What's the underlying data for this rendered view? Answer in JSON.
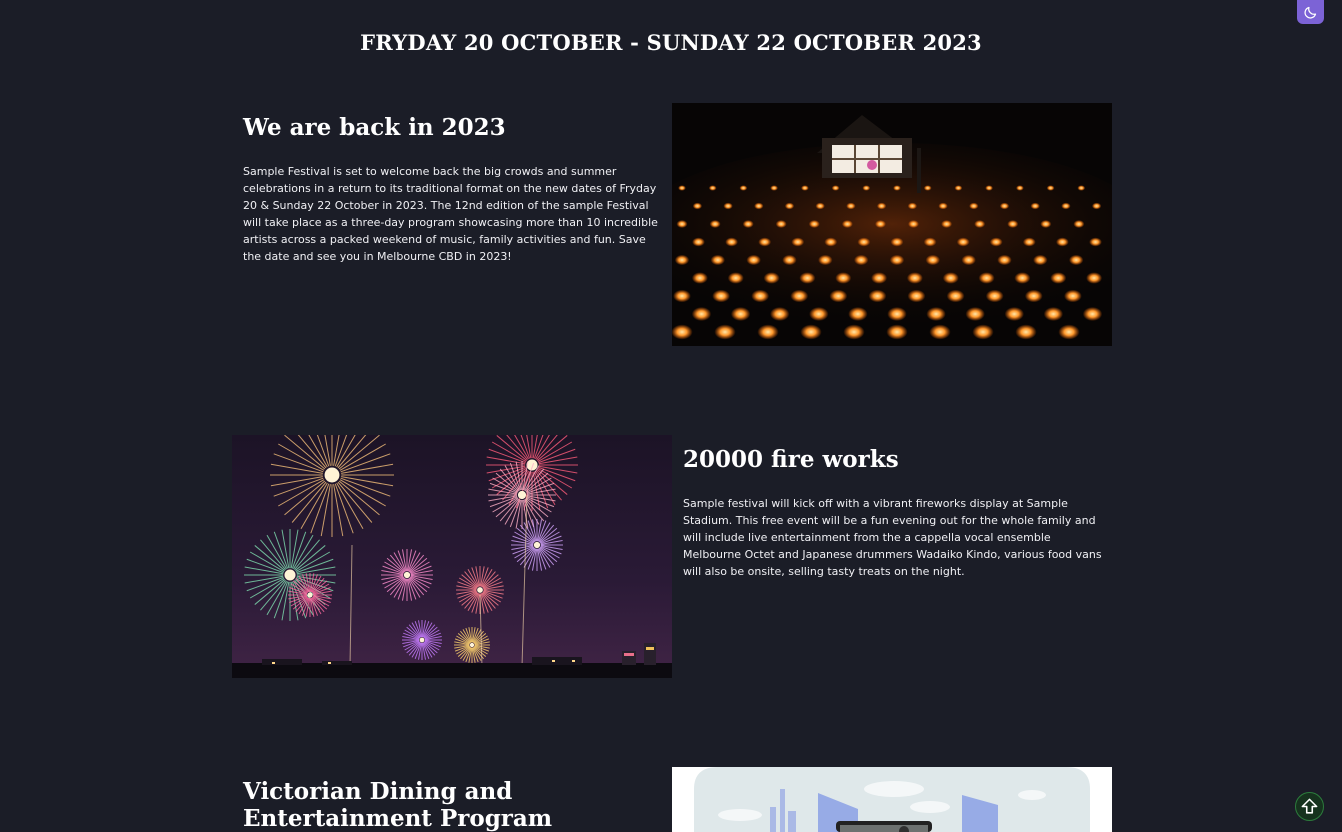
{
  "banner": {
    "date_range": "FRYDAY 20 OCTOBER - SUNDAY 22 OCTOBER 2023"
  },
  "theme_toggle": {
    "icon": "moon-icon"
  },
  "sections": [
    {
      "title": "We are back in 2023",
      "body": "Sample Festival is set to welcome back the big crowds and summer celebrations in a return to its traditional format on the new dates of Fryday 20 & Sunday 22 October in 2023. The 12nd edition of the sample Festival will take place as a three-day program showcasing more than 10 incredible artists across a packed weekend of music, family activities and fun. Save the date and see you in Melbourne CBD in 2023!",
      "image": "snow-lantern-festival-photo"
    },
    {
      "title": "20000 fire works",
      "body": "Sample festival will kick off with a vibrant fireworks display at Sample Stadium. This free event will be a fun evening out for the whole family and will include live entertainment from the a cappella vocal ensemble Melbourne Octet and Japanese drummers Wadaiko Kindo, various food vans will also be onsite, selling tasty treats on the night.",
      "image": "fireworks-photo"
    },
    {
      "title": "Victorian Dining and Entertainment Program",
      "body": "",
      "image": "city-illustration"
    }
  ],
  "scroll_top": {
    "icon": "arrow-up-icon"
  },
  "colors": {
    "background": "#1b1d27",
    "toggle_accent": "#7c63d6",
    "scroll_top_accent": "#2c7c3c"
  }
}
